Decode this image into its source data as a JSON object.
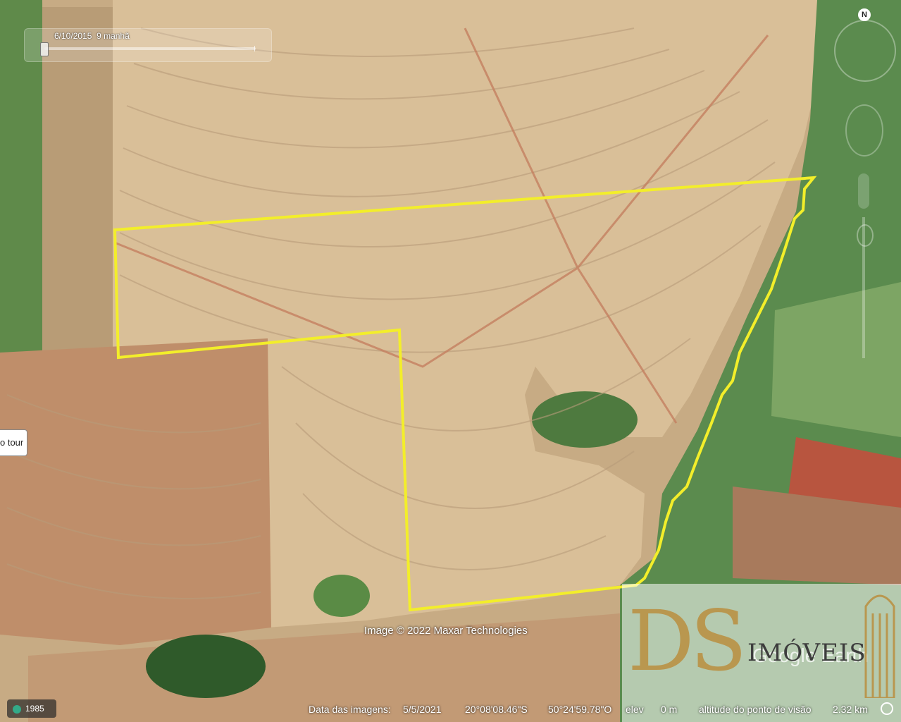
{
  "time_slider": {
    "date": "6/10/2015",
    "time": "9 manhã"
  },
  "tour_button": {
    "label": "o tour"
  },
  "navigation": {
    "north_label": "N"
  },
  "imagery_credit": "Image © 2022 Maxar Technologies",
  "status_bar": {
    "year": "1985",
    "imagery_date_label": "Data das imagens:",
    "imagery_date": "5/5/2021",
    "latitude": "20°08'08.46\"S",
    "longitude": "50°24'59.78\"O",
    "elev_label": "elev",
    "elev_value": "0 m",
    "eye_alt_label": "altitude do ponto de visão",
    "eye_alt_value": "2.32 km"
  },
  "watermark": {
    "brand": "DS",
    "text": "IMÓVEIS",
    "google_earth": "Google Earth"
  },
  "colors": {
    "boundary": "#f3ee2a",
    "field": "#d9bf98",
    "vegetation": "#4e7a3f",
    "soil_red": "#b5533d"
  },
  "icons": [
    "compass-icon",
    "street-view-icon",
    "zoom-slider-icon",
    "historical-imagery-icon"
  ]
}
